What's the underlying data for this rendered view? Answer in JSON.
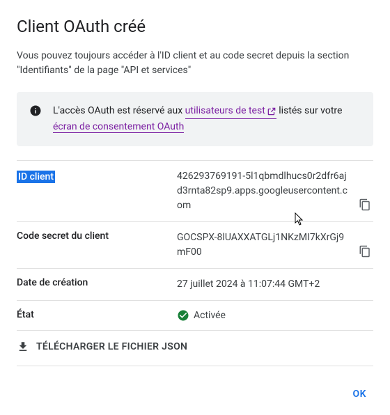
{
  "title": "Client OAuth créé",
  "intro": "Vous pouvez toujours accéder à l'ID client et au code secret depuis la section \"Identifiants\" de la page \"API et services\"",
  "info": {
    "prefix": "L'accès OAuth est réservé aux ",
    "link1": "utilisateurs de test",
    "mid": " listés sur votre ",
    "link2": "écran de consentement OAuth"
  },
  "rows": {
    "client_id": {
      "label": "ID client",
      "value": "426293769191-5l1qbmdlhucs0r2dfr6ajd3rnta82sp9.apps.googleusercontent.com"
    },
    "client_secret": {
      "label": "Code secret du client",
      "value": "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"
    },
    "created": {
      "label": "Date de création",
      "value": "27 juillet 2024 à 11:07:44 GMT+2"
    },
    "status": {
      "label": "État",
      "value": "Activée"
    }
  },
  "download_label": "TÉLÉCHARGER LE FICHIER JSON",
  "ok_label": "OK"
}
